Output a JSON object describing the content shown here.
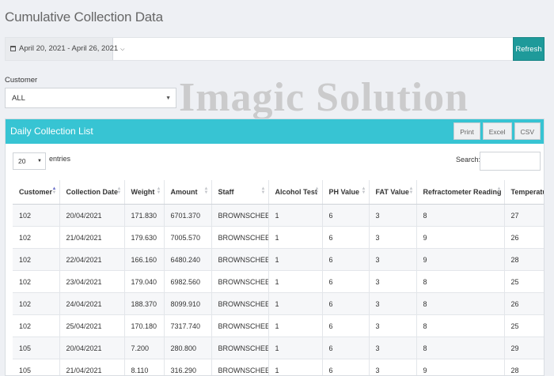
{
  "page": {
    "title": "Cumulative Collection Data"
  },
  "toolbar": {
    "date_range": "April 20, 2021 - April 26, 2021",
    "refresh_label": "Refresh"
  },
  "filter": {
    "customer_label": "Customer",
    "customer_value": "ALL"
  },
  "watermark": "Imagic Solution",
  "panel": {
    "title": "Daily Collection List",
    "export_buttons": [
      "Print",
      "Excel",
      "CSV"
    ],
    "page_length": "20",
    "entries_label": "entries",
    "search_label": "Search:"
  },
  "table": {
    "columns": [
      "Customer",
      "Collection Date",
      "Weight",
      "Amount",
      "Staff",
      "Alcohol Test",
      "PH Value",
      "FAT Value",
      "Refractometer Reading",
      "Temperatu"
    ],
    "rows": [
      [
        "102",
        "20/04/2021",
        "171.830",
        "6701.370",
        "BROWNSCHEESE",
        "1",
        "6",
        "3",
        "8",
        "27"
      ],
      [
        "102",
        "21/04/2021",
        "179.630",
        "7005.570",
        "BROWNSCHEESE",
        "1",
        "6",
        "3",
        "9",
        "26"
      ],
      [
        "102",
        "22/04/2021",
        "166.160",
        "6480.240",
        "BROWNSCHEESE",
        "1",
        "6",
        "3",
        "9",
        "28"
      ],
      [
        "102",
        "23/04/2021",
        "179.040",
        "6982.560",
        "BROWNSCHEESE",
        "1",
        "6",
        "3",
        "8",
        "25"
      ],
      [
        "102",
        "24/04/2021",
        "188.370",
        "8099.910",
        "BROWNSCHEESE",
        "1",
        "6",
        "3",
        "8",
        "26"
      ],
      [
        "102",
        "25/04/2021",
        "170.180",
        "7317.740",
        "BROWNSCHEESE",
        "1",
        "6",
        "3",
        "8",
        "25"
      ],
      [
        "105",
        "20/04/2021",
        "7.200",
        "280.800",
        "BROWNSCHEESE",
        "1",
        "6",
        "3",
        "8",
        "29"
      ],
      [
        "105",
        "21/04/2021",
        "8.110",
        "316.290",
        "BROWNSCHEESE",
        "1",
        "6",
        "3",
        "9",
        "28"
      ]
    ]
  }
}
